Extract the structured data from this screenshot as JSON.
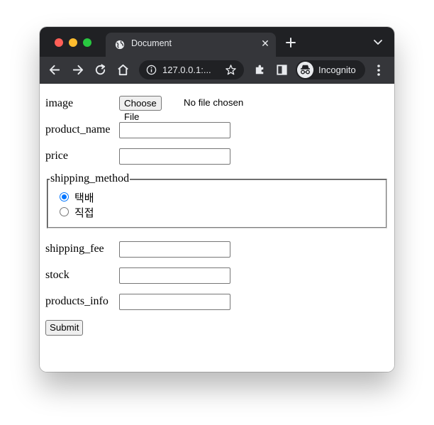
{
  "browser": {
    "tab_title": "Document",
    "url": "127.0.0.1:...",
    "profile_label": "Incognito",
    "icons": [
      "globe-icon",
      "close-icon",
      "plus-icon",
      "chevron-down-icon",
      "back-arrow-icon",
      "forward-arrow-icon",
      "reload-icon",
      "home-icon",
      "info-icon",
      "star-icon",
      "puzzle-icon",
      "sidebar-icon",
      "incognito-icon",
      "kebab-menu-icon"
    ],
    "colors": {
      "close": "#ff5f57",
      "minimize": "#febc2e",
      "maximize": "#28c840",
      "titlebar": "#202124",
      "toolbar": "#35363a",
      "radio_accent": "#0075ff"
    }
  },
  "form": {
    "image": {
      "label": "image",
      "button_label": "Choose File",
      "status": "No file chosen"
    },
    "product_name": {
      "label": "product_name",
      "value": ""
    },
    "price": {
      "label": "price",
      "value": ""
    },
    "shipping_method": {
      "legend": "shipping_method",
      "options": [
        {
          "label": "택배",
          "checked": true
        },
        {
          "label": "직접",
          "checked": false
        }
      ]
    },
    "shipping_fee": {
      "label": "shipping_fee",
      "value": ""
    },
    "stock": {
      "label": "stock",
      "value": ""
    },
    "products_info": {
      "label": "products_info",
      "value": ""
    },
    "submit_label": "Submit"
  }
}
